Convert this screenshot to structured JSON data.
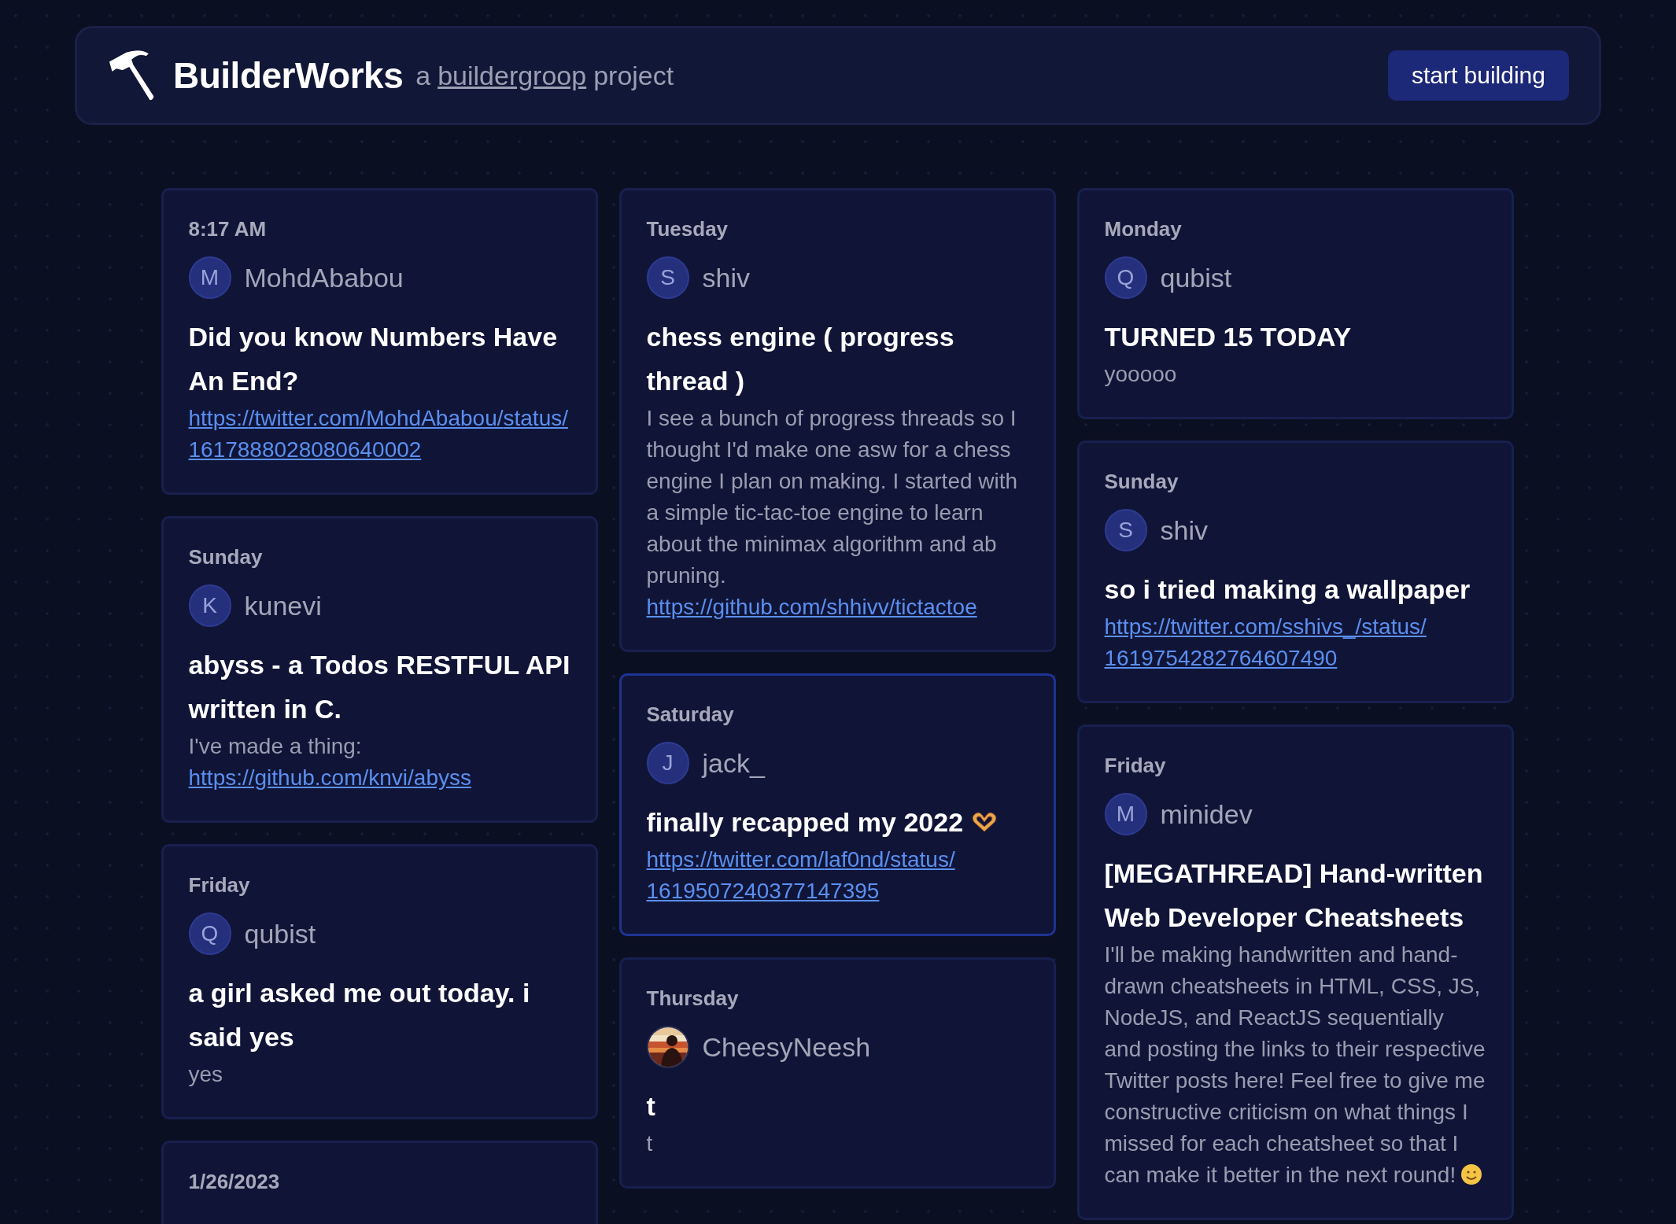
{
  "header": {
    "brand": "BuilderWorks",
    "tagline_prefix": "a",
    "tagline_link": "buildergroop",
    "tagline_suffix": "project",
    "button": "start building"
  },
  "columns": [
    {
      "cards": [
        {
          "time": "8:17 AM",
          "author": "MohdAbabou",
          "avatar": {
            "kind": "initial",
            "initial": "M"
          },
          "title": "Did you know Numbers Have An End?",
          "body": [
            {
              "kind": "link",
              "text": "https://twitter.com/MohdAbabou/status/1617888028080640002"
            }
          ]
        },
        {
          "time": "Sunday",
          "author": "kunevi",
          "avatar": {
            "kind": "initial",
            "initial": "K"
          },
          "title": "abyss - a Todos RESTFUL API written in C.",
          "body": [
            {
              "kind": "text",
              "text": "I've made a thing: "
            },
            {
              "kind": "inline_link",
              "text": "https://github.com/knvi/abyss"
            }
          ]
        },
        {
          "time": "Friday",
          "author": "qubist",
          "avatar": {
            "kind": "initial",
            "initial": "Q"
          },
          "title": "a girl asked me out today. i said yes",
          "body": [
            {
              "kind": "text",
              "text": "yes"
            }
          ]
        },
        {
          "time": "1/26/2023"
        }
      ]
    },
    {
      "cards": [
        {
          "time": "Tuesday",
          "author": "shiv",
          "avatar": {
            "kind": "initial",
            "initial": "S"
          },
          "title": "chess engine ( progress thread )",
          "body": [
            {
              "kind": "text",
              "text": "I see a bunch of progress threads so I thought I'd make one asw for a chess engine I plan on making. I started with a simple tic-tac-toe engine to learn about the minimax algorithm and ab pruning. "
            },
            {
              "kind": "link",
              "text": "https://github.com/shhivv/tictactoe"
            }
          ]
        },
        {
          "time": "Saturday",
          "author": "jack_",
          "avatar": {
            "kind": "initial",
            "initial": "J"
          },
          "highlighted": true,
          "title": "finally recapped my 2022",
          "title_icon": {
            "kind": "heart_hands"
          },
          "body": [
            {
              "kind": "link",
              "text": "https://twitter.com/laf0nd/status/1619507240377147395"
            }
          ]
        },
        {
          "time": "Thursday",
          "author": "CheesyNeesh",
          "avatar": {
            "kind": "picture"
          },
          "title": "t",
          "body": [
            {
              "kind": "text",
              "text": "t"
            }
          ]
        }
      ]
    },
    {
      "cards": [
        {
          "time": "Monday",
          "author": "qubist",
          "avatar": {
            "kind": "initial",
            "initial": "Q"
          },
          "title": "TURNED 15 TODAY",
          "body": [
            {
              "kind": "text",
              "text": "yooooo"
            }
          ]
        },
        {
          "time": "Sunday",
          "author": "shiv",
          "avatar": {
            "kind": "initial",
            "initial": "S"
          },
          "title": "so i tried making a wallpaper",
          "body": [
            {
              "kind": "link",
              "text": "https://twitter.com/sshivs_/status/1619754282764607490"
            }
          ]
        },
        {
          "time": "Friday",
          "author": "minidev",
          "avatar": {
            "kind": "initial",
            "initial": "M"
          },
          "title": "[MEGATHREAD] Hand-written Web Developer Cheatsheets",
          "body": [
            {
              "kind": "text",
              "text": "I'll be making handwritten and hand-drawn cheatsheets in HTML, CSS, JS, NodeJS, and ReactJS sequentially and posting the links to their respective Twitter posts here! Feel free to give me constructive criticism on what things I missed for each cheatsheet so that I can make it better in the next round!"
            },
            {
              "kind": "smile_emoji"
            }
          ]
        }
      ]
    }
  ]
}
